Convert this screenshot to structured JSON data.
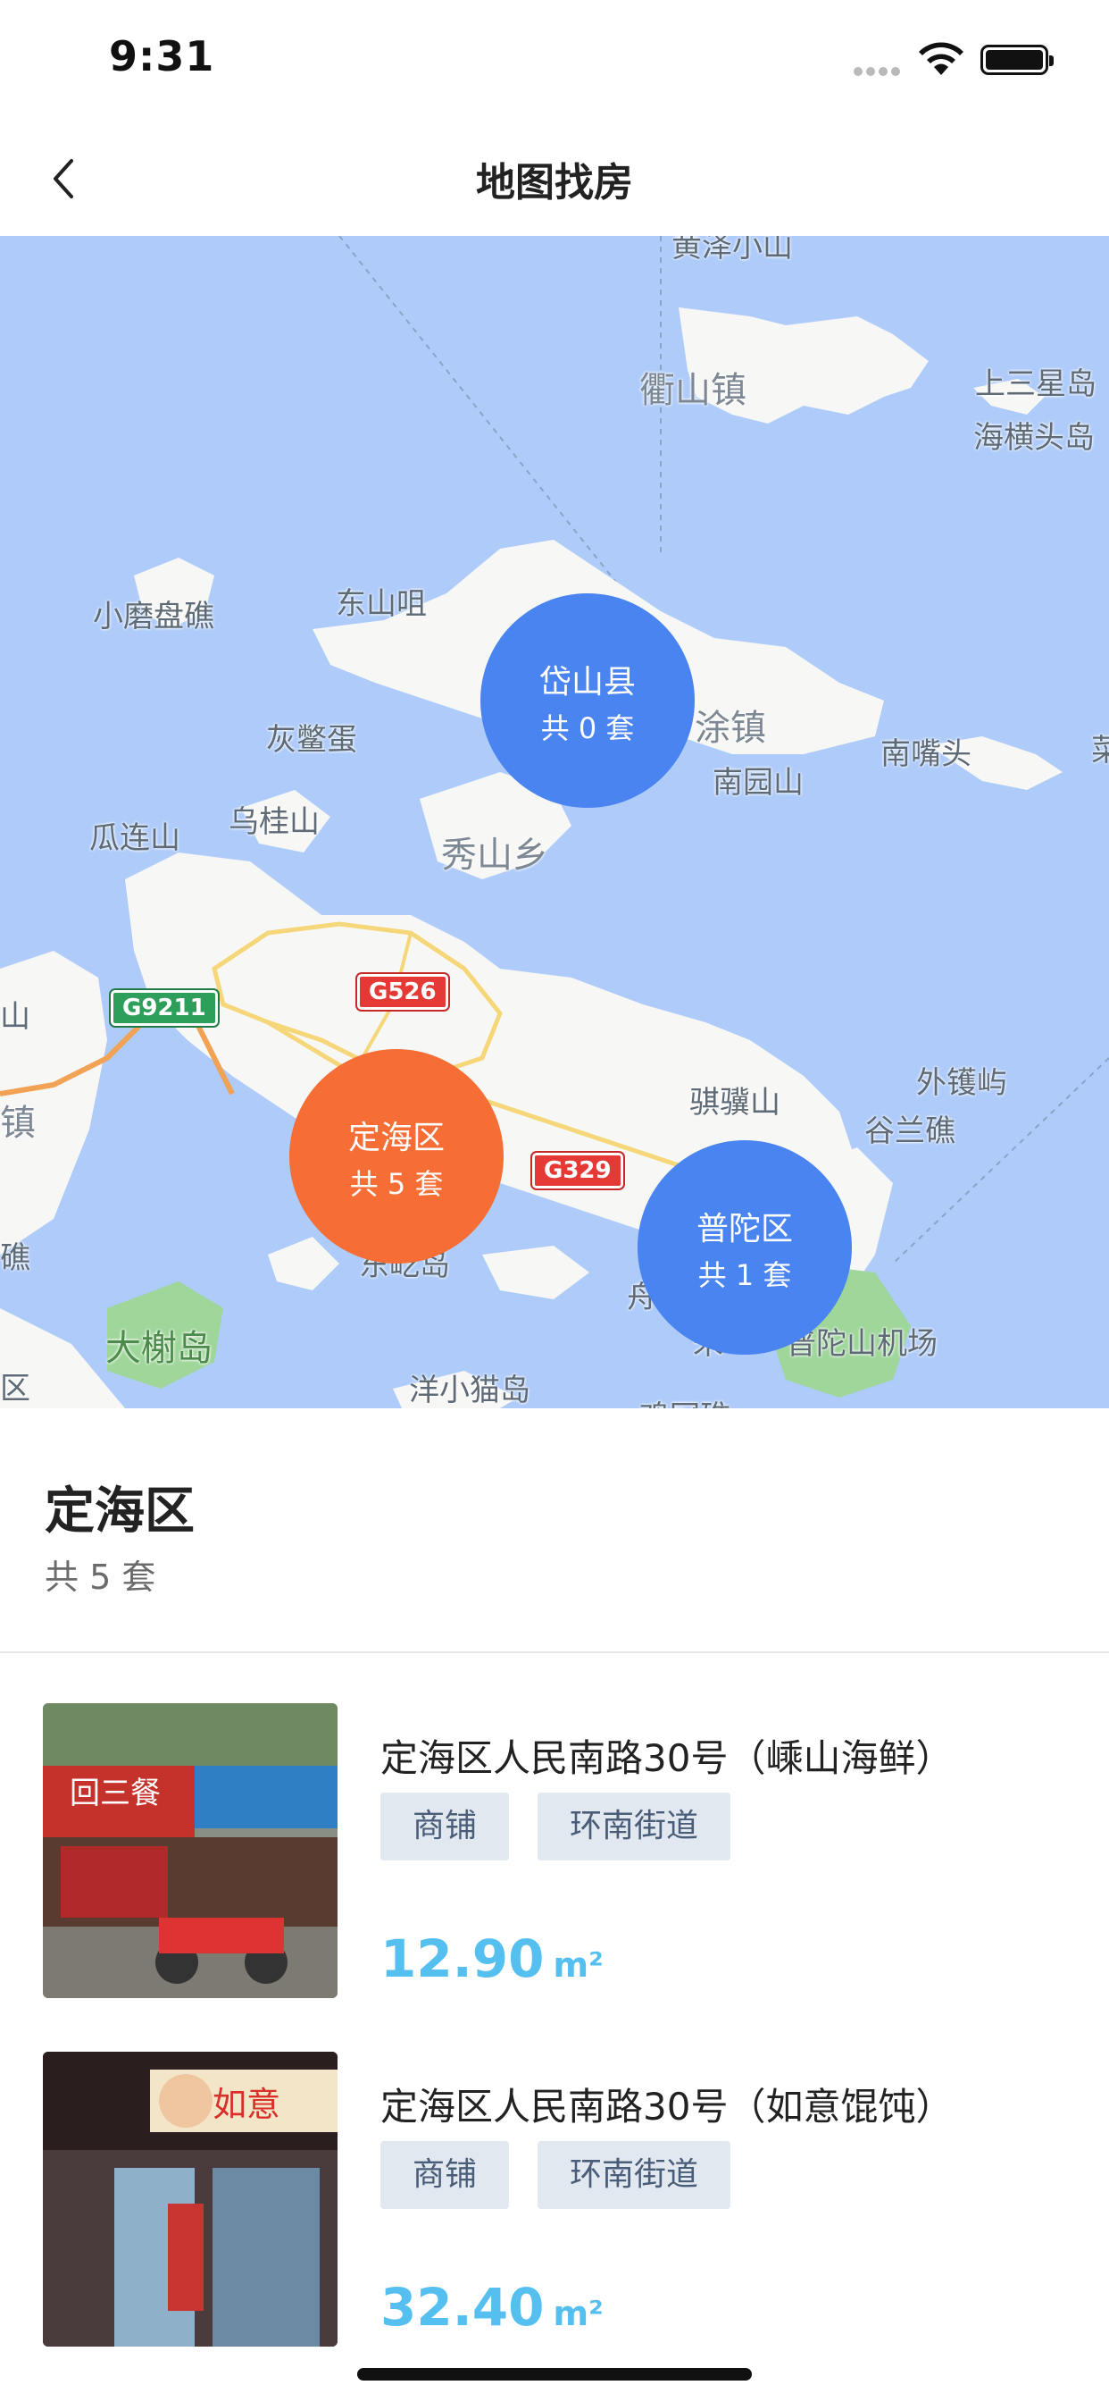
{
  "status_bar": {
    "time": "9:31"
  },
  "nav": {
    "title": "地图找房",
    "back_icon": "chevron-left-icon"
  },
  "map": {
    "labels": {
      "top_cut": "黄泽小山",
      "qushan": "衢山镇",
      "shangsanxing": "上三星岛",
      "haiheng": "海横头岛",
      "xiaomopan": "小磨盘礁",
      "dongshan": "东山咀",
      "huibie": "灰鳖蛋",
      "tuzhen": "涂镇",
      "nanzuitou": "南嘴头",
      "nanyuan": "南园山",
      "wugui": "乌桂山",
      "gualian": "瓜连山",
      "xiushan": "秀山乡",
      "left_shan": "山",
      "left_zhen": "镇",
      "left_jiao": "礁",
      "left_qu": "区",
      "waihuo": "外镬屿",
      "gulan": "谷兰礁",
      "qijishan": "骐骥山",
      "dashu": "大榭岛",
      "yangxiaomao": "洋小猫岛",
      "dongchi": "东屹岛",
      "zhou": "舟",
      "airport": "普陀山机场",
      "airport_prefix": "朱",
      "jiguan": "鸡冠礁",
      "right_cut": "菜"
    },
    "shields": {
      "g9211": "G9211",
      "g526": "G526",
      "g329": "G329"
    },
    "clusters": [
      {
        "name": "岱山县",
        "count": "共 0 套",
        "color": "#4a84f0"
      },
      {
        "name": "定海区",
        "count": "共 5 套",
        "color": "#f66d35"
      },
      {
        "name": "普陀区",
        "count": "共 1 套",
        "color": "#4a84f0"
      }
    ]
  },
  "region": {
    "title": "定海区",
    "count": "共 5 套"
  },
  "listings": [
    {
      "title": "定海区人民南路30号（嵊山海鲜）",
      "tags": [
        "商铺",
        "环南街道"
      ],
      "price": "12.90",
      "unit": "m²"
    },
    {
      "title": "定海区人民南路30号（如意馄饨）",
      "tags": [
        "商铺",
        "环南街道"
      ],
      "price": "32.40",
      "unit": "m²"
    }
  ],
  "colors": {
    "accent_price": "#55c0f0",
    "tag_bg": "#e1e8f0",
    "map_water": "#aecbfa",
    "cluster_blue": "#4a84f0",
    "cluster_orange": "#f66d35"
  }
}
